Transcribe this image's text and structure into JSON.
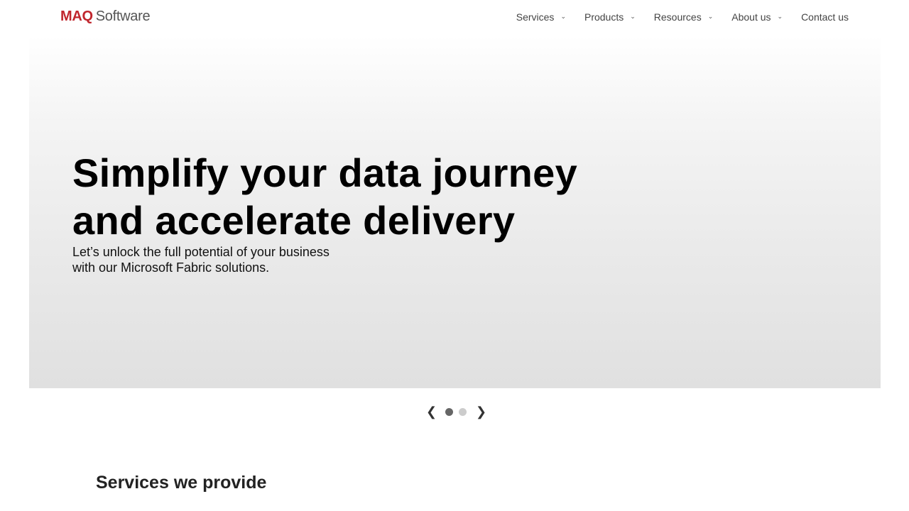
{
  "header": {
    "logo_brand": "MAQ",
    "logo_suffix": "Software",
    "nav": [
      {
        "label": "Services",
        "has_dropdown": true
      },
      {
        "label": "Products",
        "has_dropdown": true
      },
      {
        "label": "Resources",
        "has_dropdown": true
      },
      {
        "label": "About us",
        "has_dropdown": true
      },
      {
        "label": "Contact us",
        "has_dropdown": false
      }
    ],
    "chevron_glyph": "⌄"
  },
  "hero": {
    "title_line1": "Simplify your data journey",
    "title_line2": "and accelerate delivery",
    "subtitle_line1": "Let’s unlock the full potential of your business",
    "subtitle_line2": "with our Microsoft Fabric solutions."
  },
  "carousel": {
    "prev_glyph": "❮",
    "next_glyph": "❯",
    "slide_count": 2,
    "active_slide": 1
  },
  "services": {
    "title": "Services we provide"
  },
  "colors": {
    "brand_red": "#c0262d",
    "dot_active": "#666666",
    "dot_inactive": "#cccccc"
  }
}
